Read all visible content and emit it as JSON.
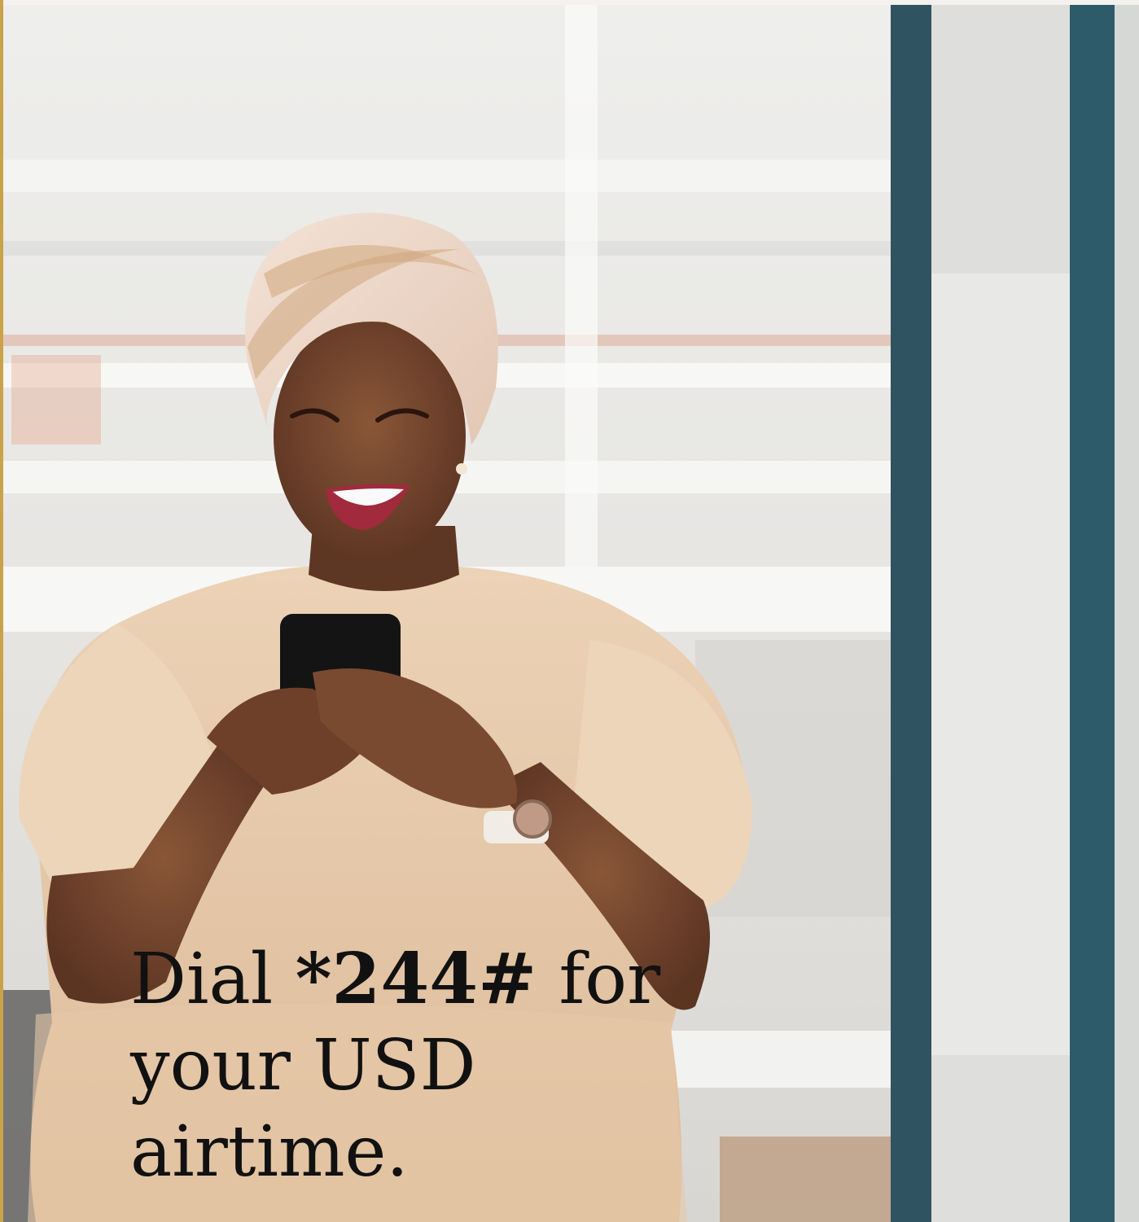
{
  "ad": {
    "caption_prefix": "Dial ",
    "code": "*244#",
    "caption_suffix_line1": " for",
    "caption_line2": "your USD",
    "caption_line3": "airtime."
  },
  "colors": {
    "accent_edge": "#c9a24a",
    "text": "#111111"
  }
}
